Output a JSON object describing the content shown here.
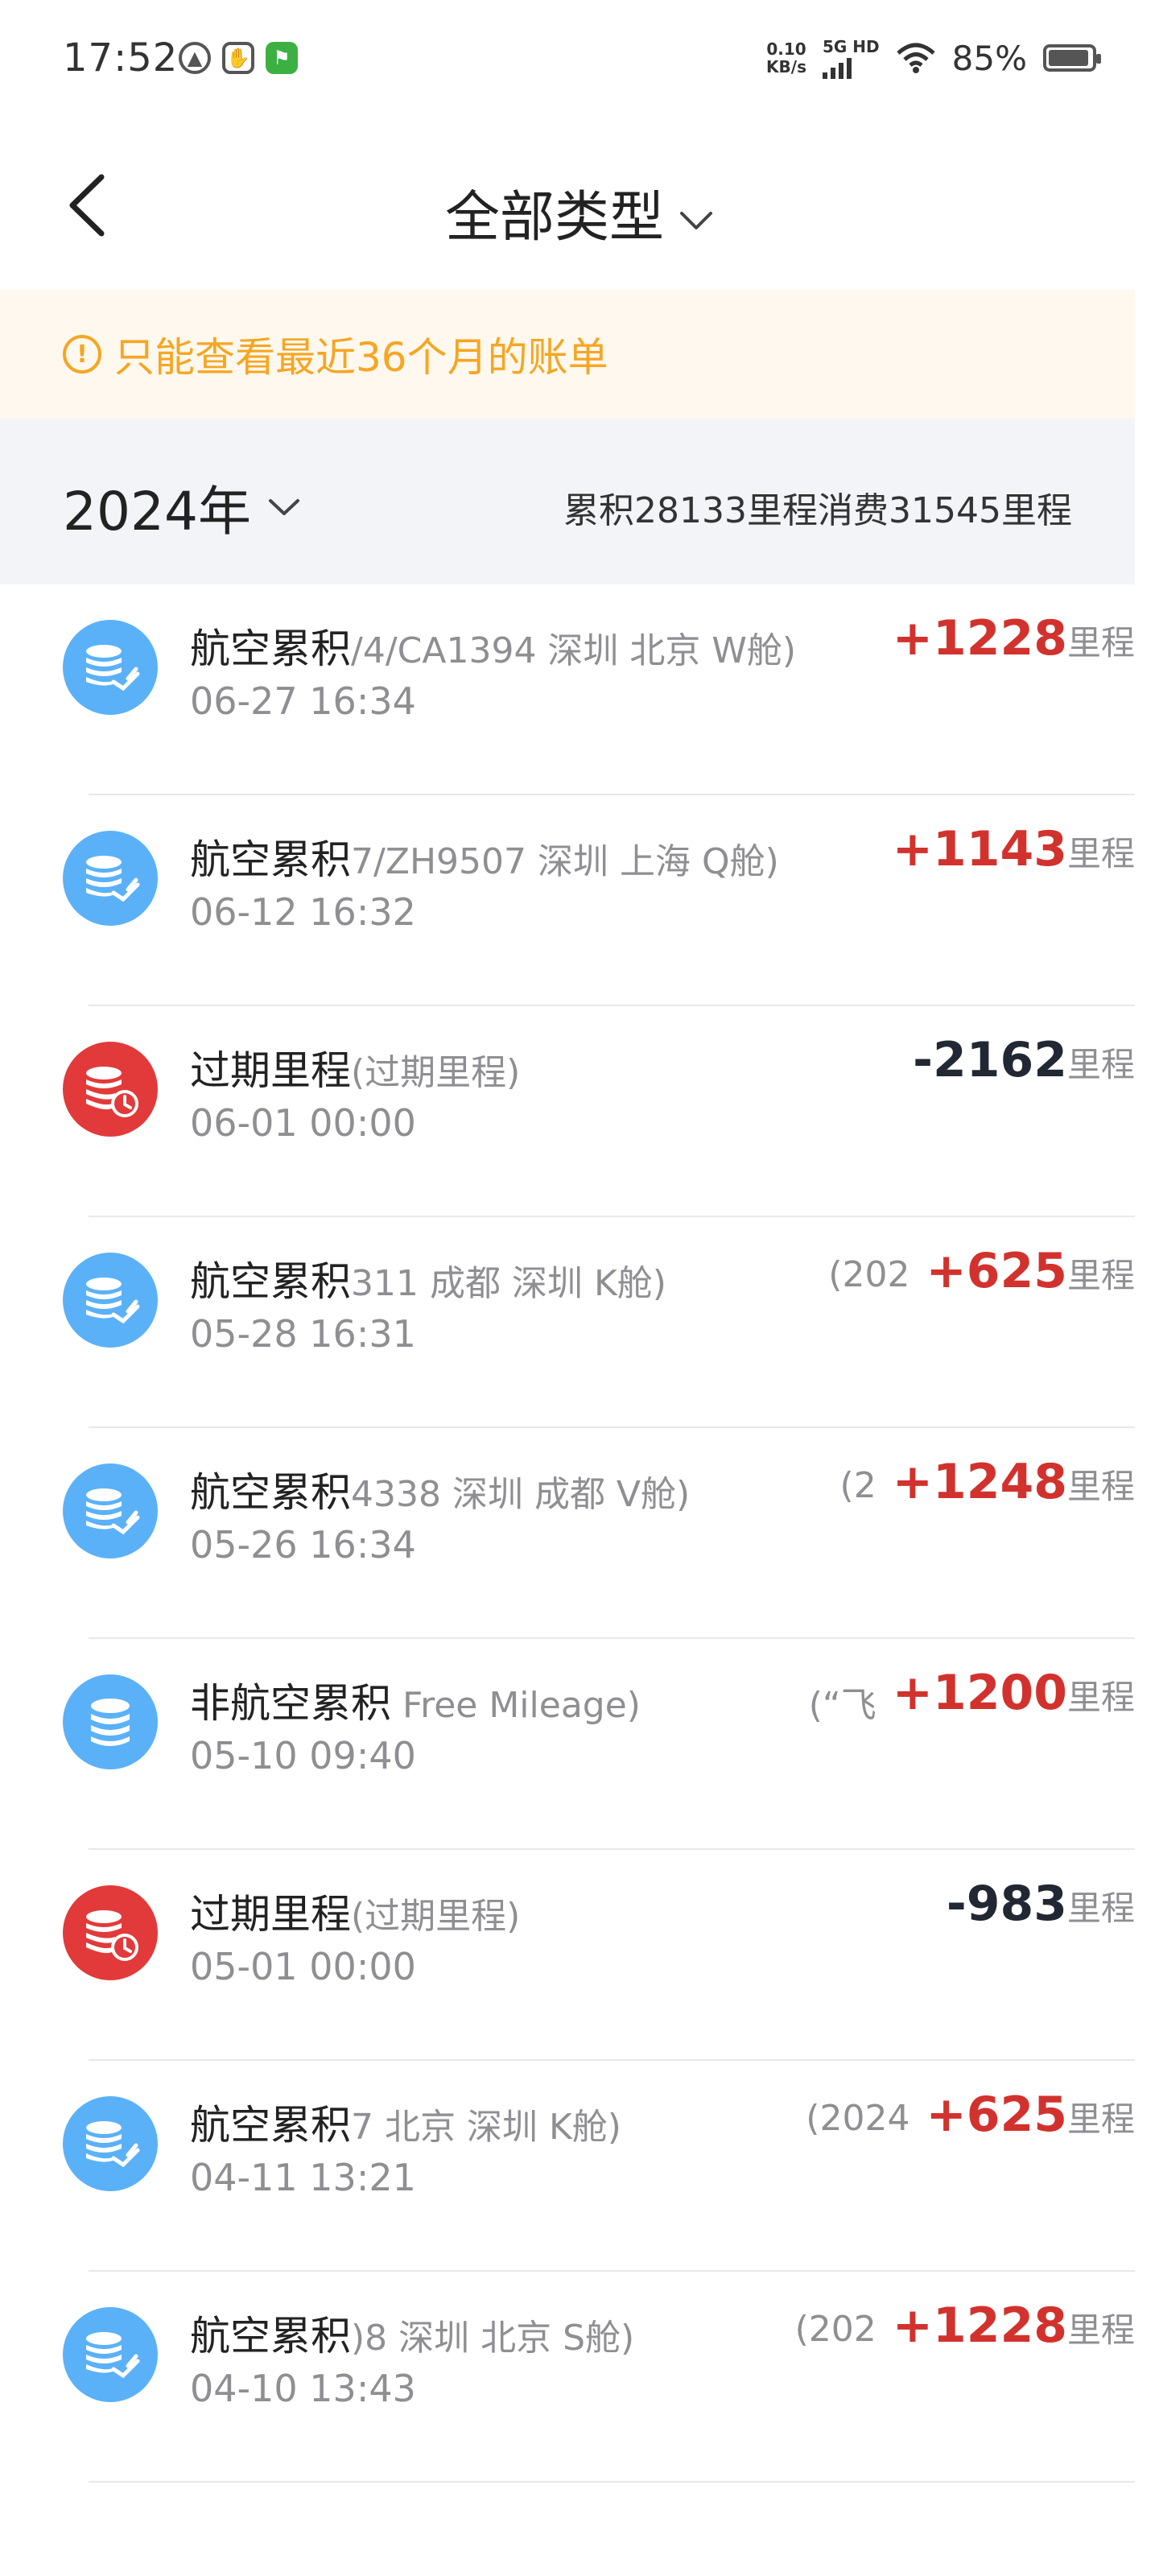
{
  "status_bar": {
    "time": "17:52",
    "speed_value": "0.10",
    "speed_unit": "KB/s",
    "network": "5G HD",
    "battery": "85%"
  },
  "nav": {
    "title": "全部类型"
  },
  "notice": {
    "text": "只能查看最近36个月的账单"
  },
  "year_header": {
    "year": "2024年",
    "summary": "累积28133里程消费31545里程"
  },
  "records": [
    {
      "type": "航空累积",
      "desc": "/4/CA1394 深圳 北京 W舱)",
      "prefix": "",
      "time": "06-27 16:34",
      "amount": "+1228",
      "unit": "里程",
      "kind": "flight",
      "sign": "pos"
    },
    {
      "type": "航空累积",
      "desc": "7/ZH9507 深圳 上海 Q舱)",
      "prefix": "",
      "time": "06-12 16:32",
      "amount": "+1143",
      "unit": "里程",
      "kind": "flight",
      "sign": "pos"
    },
    {
      "type": "过期里程",
      "desc": "(过期里程)",
      "prefix": "",
      "time": "06-01 00:00",
      "amount": "-2162",
      "unit": "里程",
      "kind": "expire",
      "sign": "neg"
    },
    {
      "type": "航空累积",
      "desc": "311 成都 深圳 K舱)",
      "prefix": "(202",
      "time": "05-28 16:31",
      "amount": "+625",
      "unit": "里程",
      "kind": "flight",
      "sign": "pos"
    },
    {
      "type": "航空累积",
      "desc": "4338 深圳 成都 V舱)",
      "prefix": "(2",
      "time": "05-26 16:34",
      "amount": "+1248",
      "unit": "里程",
      "kind": "flight",
      "sign": "pos"
    },
    {
      "type": "非航空累积",
      "desc": " Free Mileage)",
      "prefix": "(“飞",
      "time": "05-10 09:40",
      "amount": "+1200",
      "unit": "里程",
      "kind": "nonflight",
      "sign": "pos"
    },
    {
      "type": "过期里程",
      "desc": "(过期里程)",
      "prefix": "",
      "time": "05-01 00:00",
      "amount": "-983",
      "unit": "里程",
      "kind": "expire",
      "sign": "neg"
    },
    {
      "type": "航空累积",
      "desc": "7 北京 深圳 K舱)",
      "prefix": "(2024",
      "time": "04-11 13:21",
      "amount": "+625",
      "unit": "里程",
      "kind": "flight",
      "sign": "pos"
    },
    {
      "type": "航空累积",
      "desc": ")8 深圳 北京 S舱)",
      "prefix": "(202",
      "time": "04-10 13:43",
      "amount": "+1228",
      "unit": "里程",
      "kind": "flight",
      "sign": "pos"
    }
  ],
  "icons": {
    "flight": "coin-stack-plane-icon",
    "expire": "coin-stack-clock-icon",
    "nonflight": "coin-stack-icon"
  },
  "colors": {
    "positive": "#d2322d",
    "negative": "#222833",
    "notice": "#f5a623",
    "flight_icon_bg": "#5ab1f8",
    "expire_icon_bg": "#e23a3a"
  }
}
